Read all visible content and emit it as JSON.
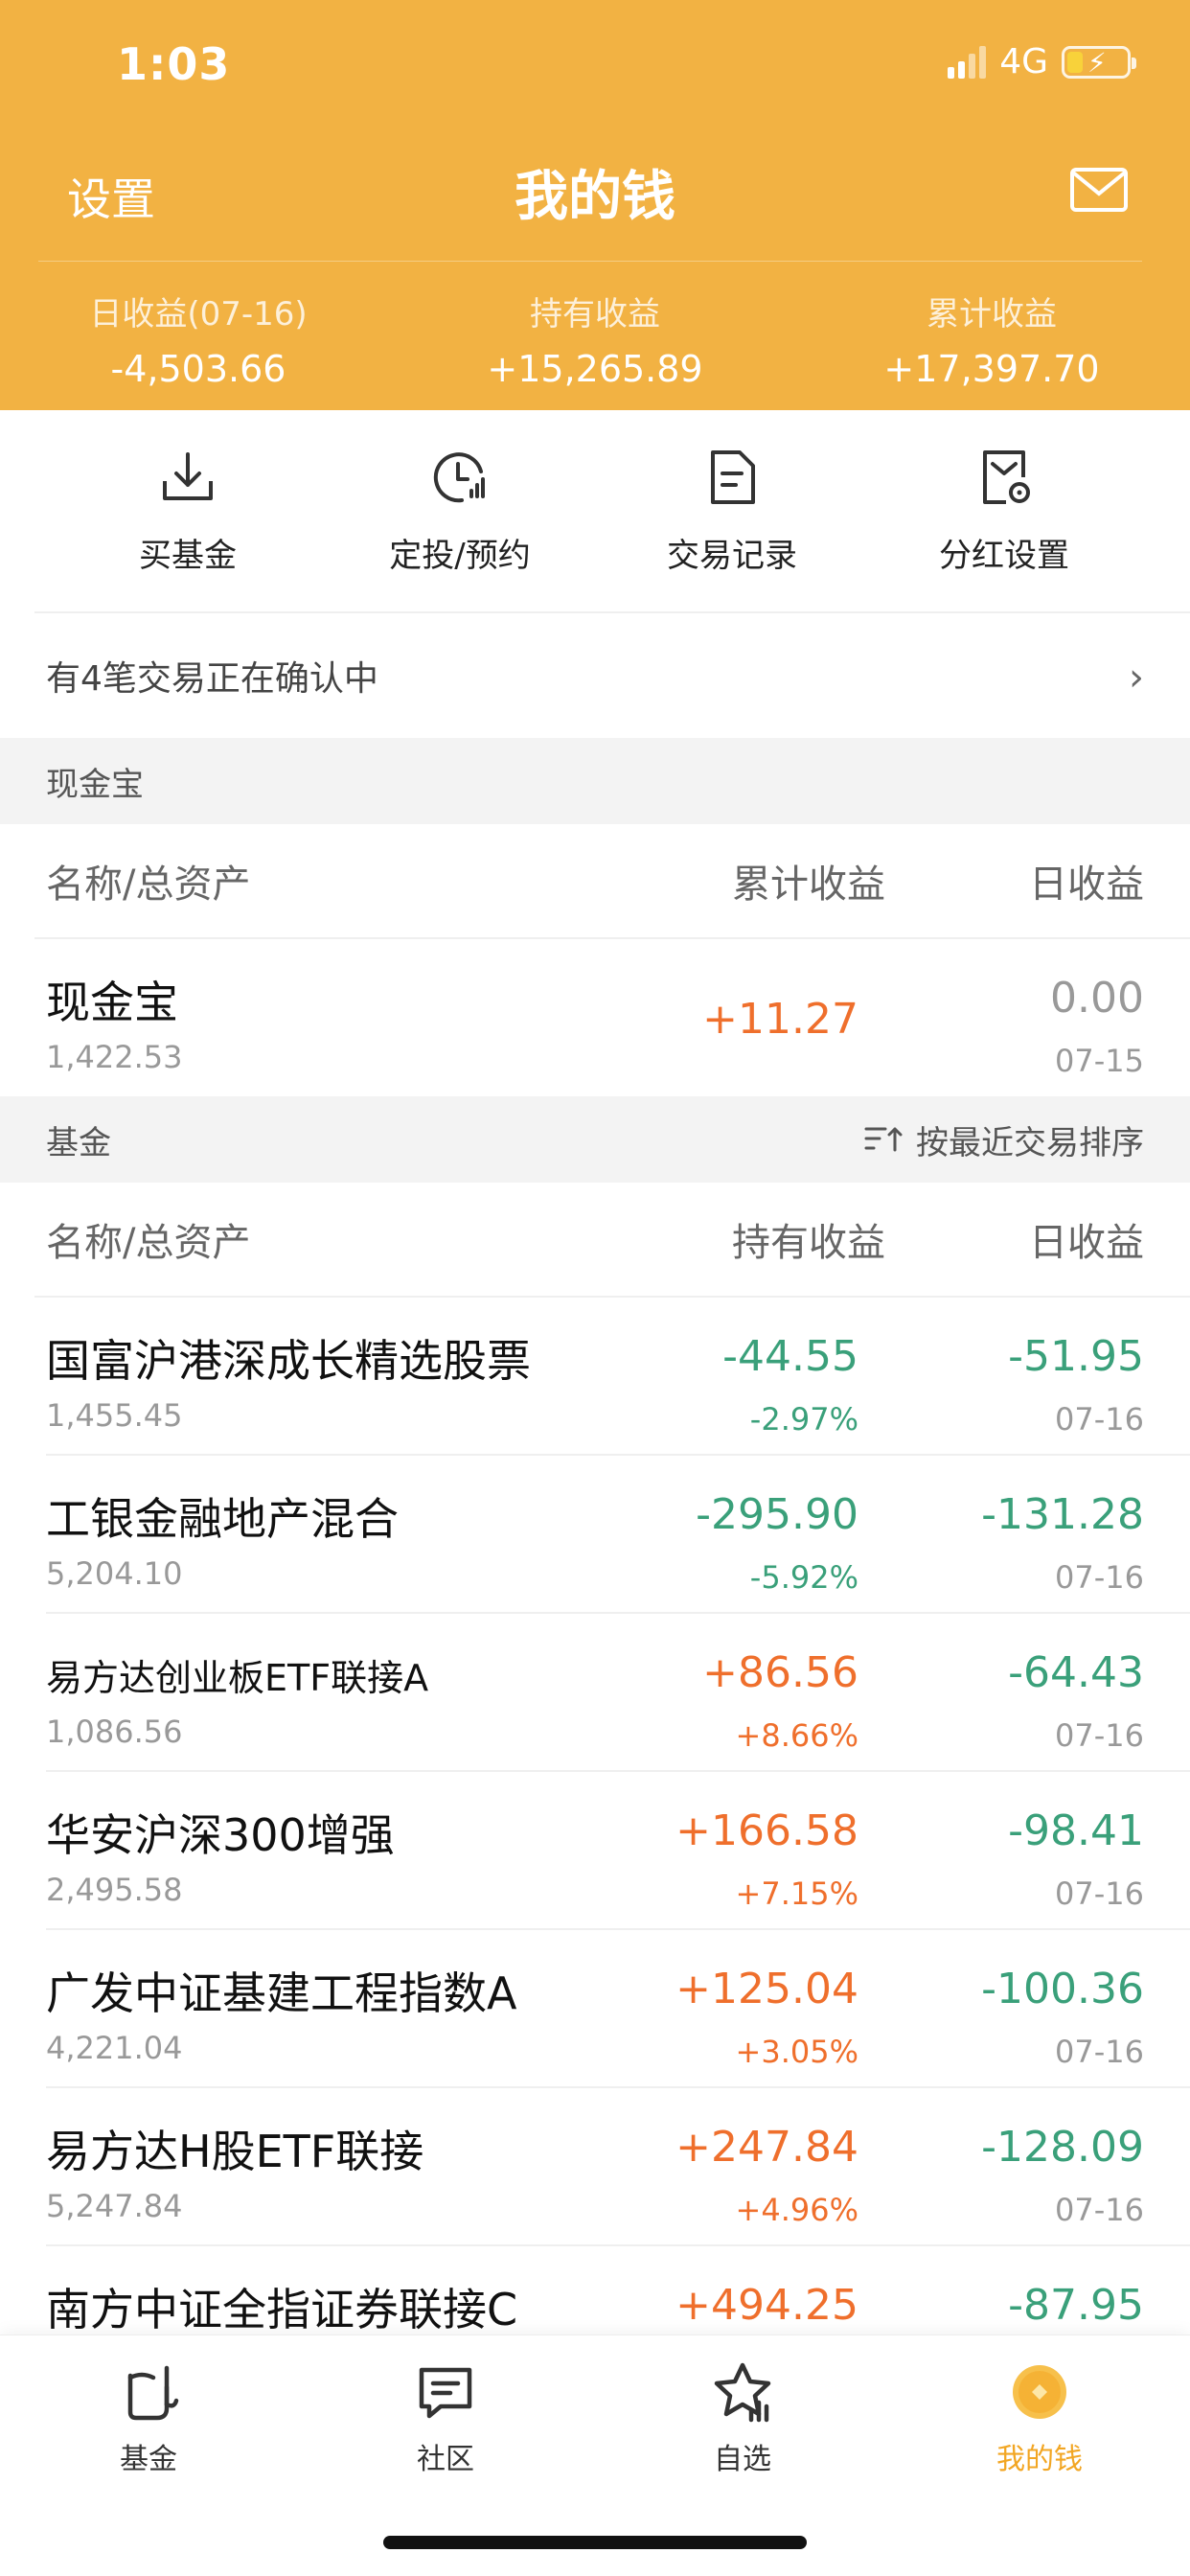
{
  "status": {
    "time": "1:03",
    "network": "4G"
  },
  "nav": {
    "left": "设置",
    "title": "我的钱"
  },
  "stats": [
    {
      "label": "日收益(07-16)",
      "value": "-4,503.66"
    },
    {
      "label": "持有收益",
      "value": "+15,265.89"
    },
    {
      "label": "累计收益",
      "value": "+17,397.70"
    }
  ],
  "actions": [
    {
      "label": "买基金",
      "icon": "download-icon"
    },
    {
      "label": "定投/预约",
      "icon": "clock-chart-icon"
    },
    {
      "label": "交易记录",
      "icon": "document-icon"
    },
    {
      "label": "分红设置",
      "icon": "dividend-settings-icon"
    }
  ],
  "notice": "有4笔交易正在确认中",
  "cash_section": {
    "title": "现金宝",
    "headers": [
      "名称/总资产",
      "累计收益",
      "日收益"
    ],
    "item": {
      "name": "现金宝",
      "asset": "1,422.53",
      "cumulative": "+11.27",
      "daily": "0.00",
      "date": "07-15"
    }
  },
  "fund_section": {
    "title": "基金",
    "sort": "按最近交易排序",
    "headers": [
      "名称/总资产",
      "持有收益",
      "日收益"
    ],
    "items": [
      {
        "name": "国富沪港深成长精选股票",
        "asset": "1,455.45",
        "hold": "-44.55",
        "hold_pct": "-2.97%",
        "daily": "-51.95",
        "date": "07-16"
      },
      {
        "name": "工银金融地产混合",
        "asset": "5,204.10",
        "hold": "-295.90",
        "hold_pct": "-5.92%",
        "daily": "-131.28",
        "date": "07-16"
      },
      {
        "name": "易方达创业板ETF联接A",
        "asset": "1,086.56",
        "hold": "+86.56",
        "hold_pct": "+8.66%",
        "daily": "-64.43",
        "date": "07-16"
      },
      {
        "name": "华安沪深300增强",
        "asset": "2,495.58",
        "hold": "+166.58",
        "hold_pct": "+7.15%",
        "daily": "-98.41",
        "date": "07-16"
      },
      {
        "name": "广发中证基建工程指数A",
        "asset": "4,221.04",
        "hold": "+125.04",
        "hold_pct": "+3.05%",
        "daily": "-100.36",
        "date": "07-16"
      },
      {
        "name": "易方达H股ETF联接",
        "asset": "5,247.84",
        "hold": "+247.84",
        "hold_pct": "+4.96%",
        "daily": "-128.09",
        "date": "07-16"
      },
      {
        "name": "南方中证全指证券联接C",
        "hold": "+494.25",
        "daily": "-87.95"
      }
    ]
  },
  "tabs": [
    {
      "label": "基金",
      "icon": "fund-icon"
    },
    {
      "label": "社区",
      "icon": "chat-icon"
    },
    {
      "label": "自选",
      "icon": "star-chart-icon"
    },
    {
      "label": "我的钱",
      "icon": "coin-icon"
    }
  ],
  "colors": {
    "brand": "#f2b243",
    "up": "#ef6f2c",
    "down": "#3aa07a",
    "active_tab": "#f2a623"
  }
}
